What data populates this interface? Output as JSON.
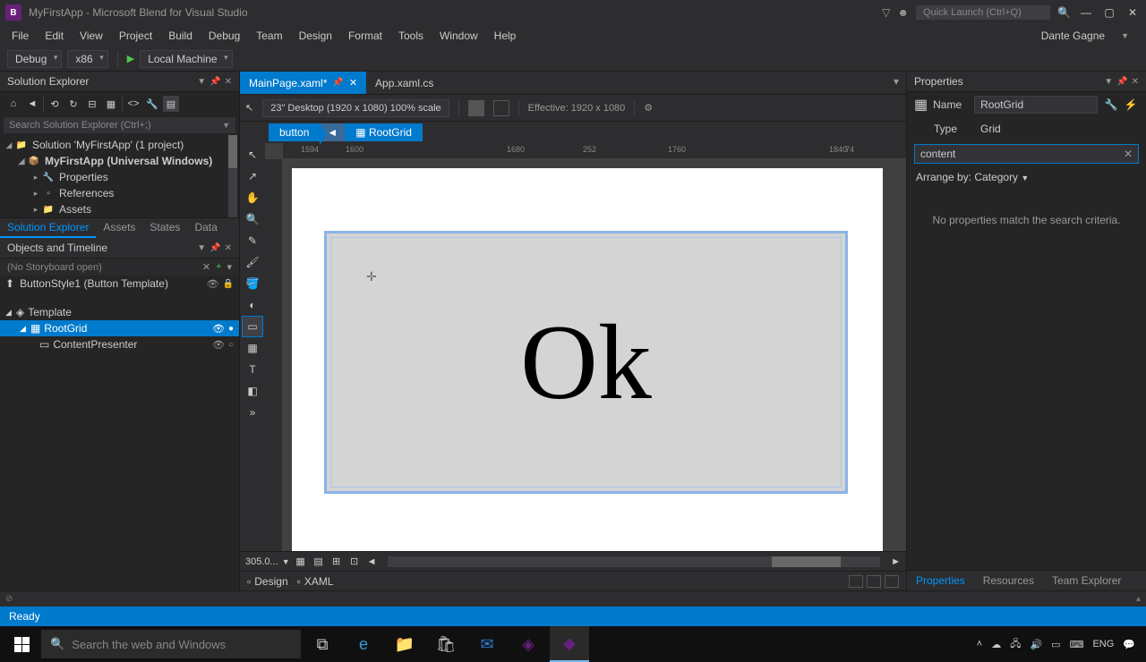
{
  "titlebar": {
    "title": "MyFirstApp - Microsoft Blend for Visual Studio",
    "quick_launch": "Quick Launch (Ctrl+Q)",
    "user": "Dante Gagne"
  },
  "menu": [
    "File",
    "Edit",
    "View",
    "Project",
    "Build",
    "Debug",
    "Team",
    "Design",
    "Format",
    "Tools",
    "Window",
    "Help"
  ],
  "toolbar": {
    "config": "Debug",
    "platform": "x86",
    "run": "Local Machine"
  },
  "solution_explorer": {
    "title": "Solution Explorer",
    "search_placeholder": "Search Solution Explorer (Ctrl+;)",
    "solution": "Solution 'MyFirstApp' (1 project)",
    "project": "MyFirstApp (Universal Windows)",
    "nodes": [
      "Properties",
      "References",
      "Assets"
    ],
    "tabs": [
      "Solution Explorer",
      "Assets",
      "States",
      "Data"
    ]
  },
  "objects": {
    "title": "Objects and Timeline",
    "storyboard": "(No Storyboard open)",
    "template": "ButtonStyle1 (Button Template)",
    "root": "Template",
    "grid": "RootGrid",
    "content": "ContentPresenter"
  },
  "doctabs": {
    "active": "MainPage.xaml*",
    "other": "App.xaml.cs"
  },
  "designbar": {
    "device": "23\" Desktop (1920 x 1080) 100% scale",
    "effective": "Effective: 1920 x 1080"
  },
  "breadcrumb": {
    "a": "button",
    "b": "RootGrid"
  },
  "ruler": {
    "r1": "1594",
    "r2": "1600",
    "r3": "1680",
    "r4": "252",
    "r5": "1760",
    "r6": "1840",
    "r7": "74"
  },
  "canvas": {
    "ok": "Ok",
    "zoom": "305.0..."
  },
  "dx": {
    "design": "Design",
    "xaml": "XAML"
  },
  "properties": {
    "title": "Properties",
    "name_label": "Name",
    "name_value": "RootGrid",
    "type_label": "Type",
    "type_value": "Grid",
    "search": "content",
    "arrange": "Arrange by: Category",
    "nomatch": "No properties match the search criteria.",
    "tabs": [
      "Properties",
      "Resources",
      "Team Explorer"
    ]
  },
  "status": "Ready",
  "taskbar": {
    "search": "Search the web and Windows",
    "time": "",
    "lang": "ENG"
  }
}
